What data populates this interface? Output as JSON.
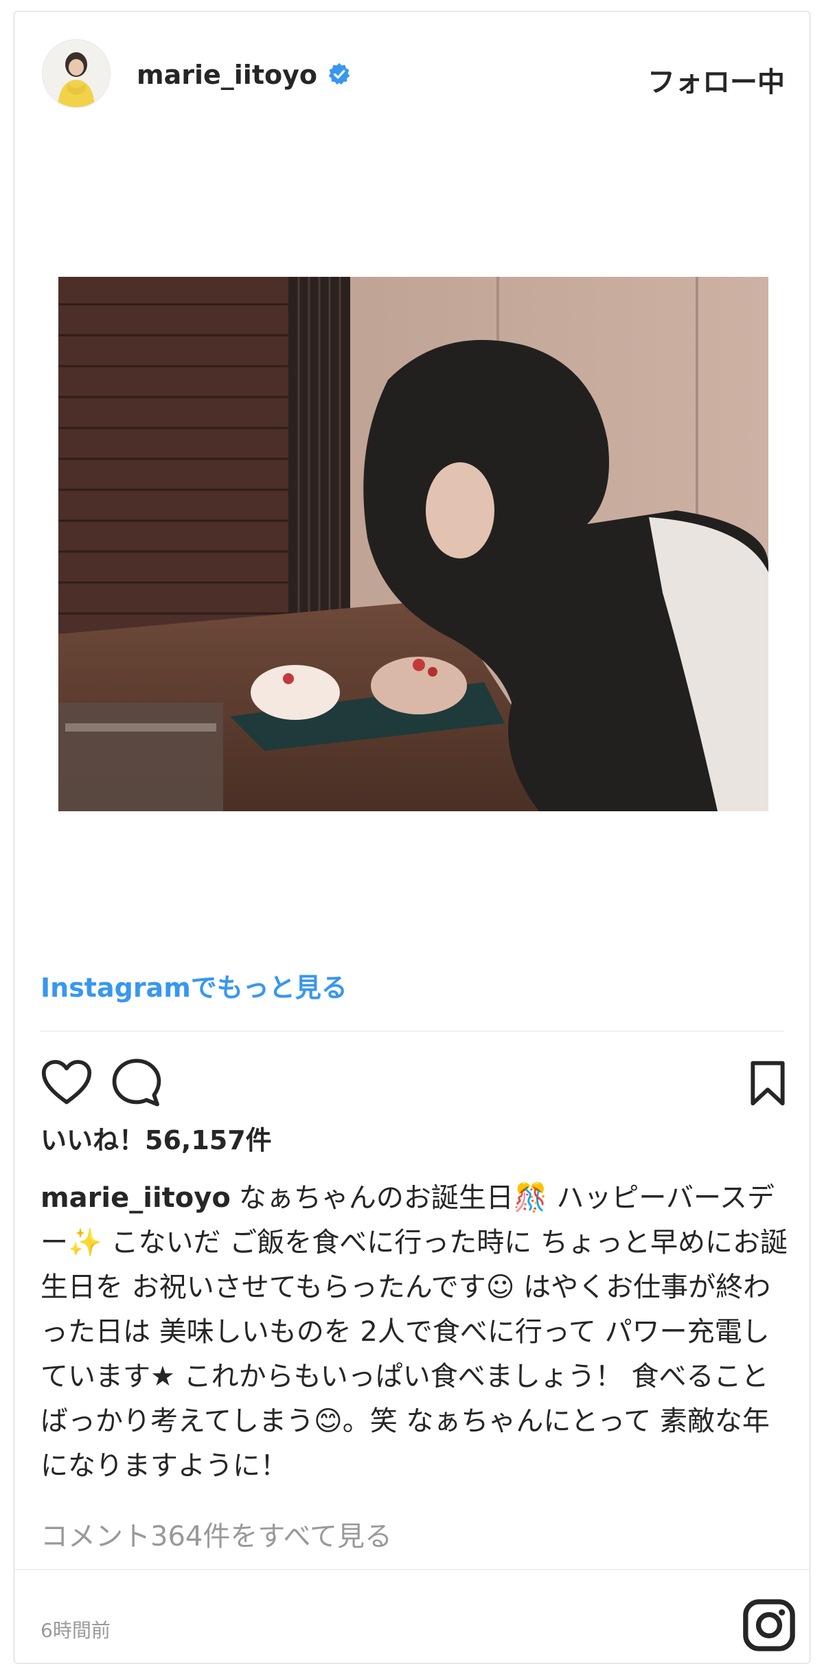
{
  "header": {
    "username": "marie_iitoyo",
    "follow_label": "フォロー中"
  },
  "post": {
    "image_alt": "",
    "more_link": "Instagramでもっと見る",
    "likes_text": "いいね！56,157件",
    "caption_username": "marie_iitoyo",
    "caption_text": "なぁちゃんのお誕生日🎊 ハッピーバースデー✨ こないだ ご飯を食べに行った時に ちょっと早めにお誕生日を お祝いさせてもらったんです☺ はやくお仕事が終わった日は 美味しいものを 2人で食べに行って パワー充電しています★ これからもいっぱい食べましょう！ 食べることばっかり考えてしまう😊。笑 なぁちゃんにとって 素敵な年になりますように！",
    "comments_link": "コメント364件をすべて見る",
    "timestamp": "6時間前"
  },
  "icons": {
    "verified": "verified-badge-icon",
    "like": "heart-icon",
    "comment": "comment-bubble-icon",
    "save": "bookmark-icon",
    "logo": "instagram-logo-icon"
  },
  "colors": {
    "link": "#3897f0",
    "verified": "#3897f0",
    "text": "#262626",
    "muted": "#999999"
  }
}
